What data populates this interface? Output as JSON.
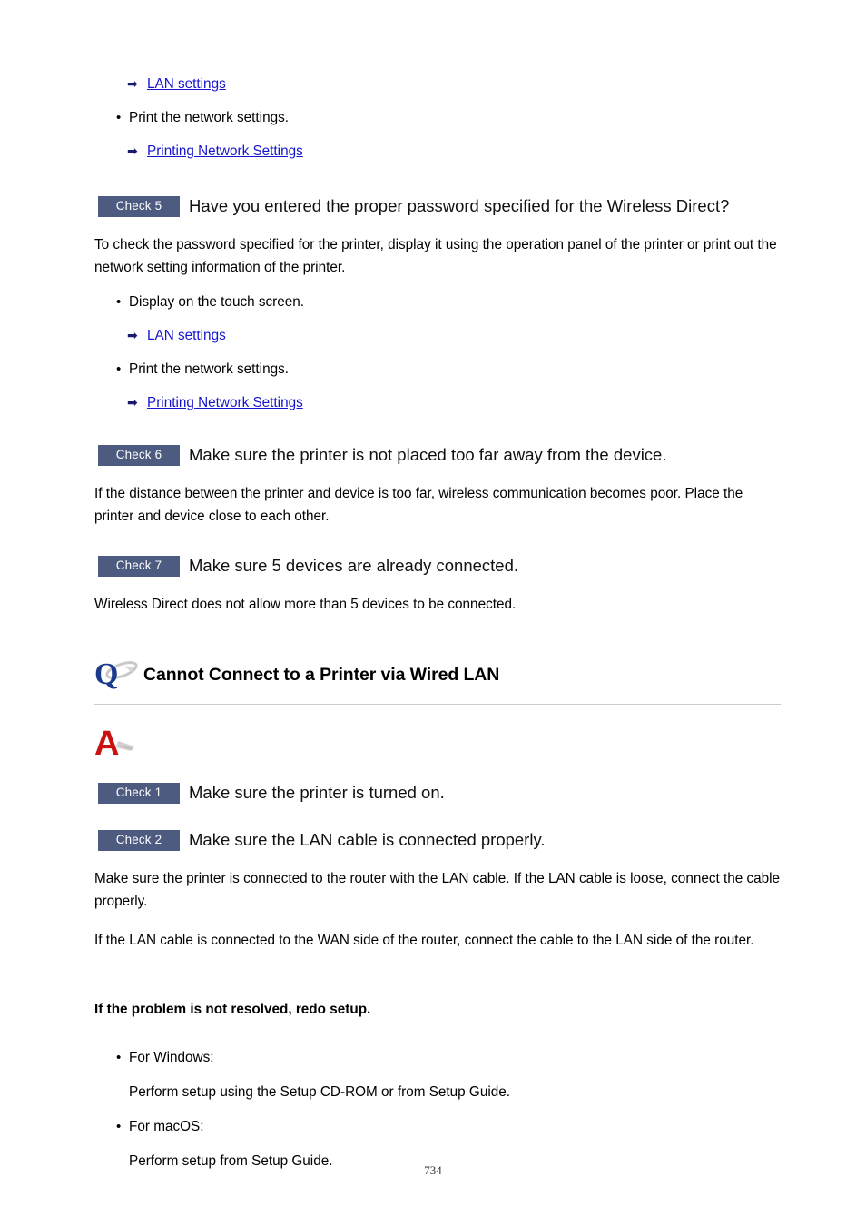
{
  "page": {
    "number": "734"
  },
  "top_section": {
    "link_lan_settings": "LAN settings",
    "bullet_print_network": "Print the network settings.",
    "link_printing_network": "Printing Network Settings"
  },
  "check5": {
    "badge": "Check 5",
    "title": "Have you entered the proper password specified for the Wireless Direct?",
    "body": "To check the password specified for the printer, display it using the operation panel of the printer or print out the network setting information of the printer.",
    "bullet_display": "Display on the touch screen.",
    "link_lan_settings": "LAN settings",
    "bullet_print": "Print the network settings.",
    "link_printing_network": "Printing Network Settings"
  },
  "check6": {
    "badge": "Check 6",
    "title": "Make sure the printer is not placed too far away from the device.",
    "body": "If the distance between the printer and device is too far, wireless communication becomes poor. Place the printer and device close to each other."
  },
  "check7": {
    "badge": "Check 7",
    "title": "Make sure 5 devices are already connected.",
    "body": "Wireless Direct does not allow more than 5 devices to be connected."
  },
  "question": {
    "glyph": "Q",
    "title": "Cannot Connect to a Printer via Wired LAN"
  },
  "answer": {
    "glyph": "A"
  },
  "check1": {
    "badge": "Check 1",
    "title": "Make sure the printer is turned on."
  },
  "check2": {
    "badge": "Check 2",
    "title": "Make sure the LAN cable is connected properly.",
    "body1": "Make sure the printer is connected to the router with the LAN cable. If the LAN cable is loose, connect the cable properly.",
    "body2": "If the LAN cable is connected to the WAN side of the router, connect the cable to the LAN side of the router."
  },
  "redo_setup": {
    "heading": "If the problem is not resolved, redo setup.",
    "bullet_windows": "For Windows:",
    "windows_detail": "Perform setup using the Setup CD-ROM or from Setup Guide.",
    "bullet_macos": "For macOS:",
    "macos_detail": "Perform setup from Setup Guide."
  },
  "icons": {
    "arrow": "➡",
    "bullet": "•"
  },
  "colors": {
    "badge_bg": "#4d5b80",
    "link": "#1515cf",
    "arrow": "#1a1a6e",
    "q_glyph": "#1b3a8c",
    "a_glyph": "#cc1111",
    "swoosh": "#b8b8b8"
  }
}
